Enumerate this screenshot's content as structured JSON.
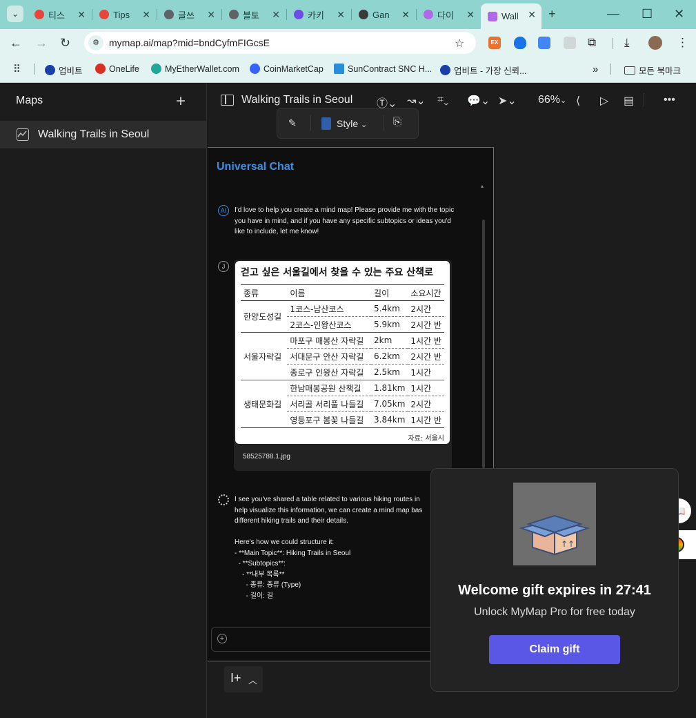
{
  "browser": {
    "tabs": [
      {
        "label": "티스",
        "color": "#e8453c"
      },
      {
        "label": "Tips",
        "color": "#e8453c"
      },
      {
        "label": "글쓰",
        "color": "#5f6368"
      },
      {
        "label": "블토",
        "color": "#5f6368"
      },
      {
        "label": "카키",
        "color": "#6c4de6"
      },
      {
        "label": "Gan",
        "color": "#3a3a3a"
      },
      {
        "label": "다이",
        "color": "#b06ae6"
      },
      {
        "label": "Wall",
        "color": "#b06ae6"
      }
    ],
    "new_tab": "+",
    "address": "mymap.ai/map?mid=bndCyfmFIGcsE",
    "bookmarks": [
      {
        "label": "업비트",
        "color": "#1b3fa8"
      },
      {
        "label": "OneLife",
        "color": "#d93025"
      },
      {
        "label": "MyEtherWallet.com",
        "color": "#21a69a"
      },
      {
        "label": "CoinMarketCap",
        "color": "#3861fb"
      },
      {
        "label": "SunContract SNC H...",
        "color": "#2b8dd6"
      },
      {
        "label": "업비트 - 가장 신뢰...",
        "color": "#1b3fa8"
      }
    ],
    "bookmarks_overflow": "»",
    "all_bookmarks": "모든 북마크",
    "ext_badge": "EX"
  },
  "sidebar": {
    "title": "Maps",
    "add": "+",
    "items": [
      {
        "label": "Walking Trails in Seoul"
      }
    ]
  },
  "toolbar": {
    "map_title": "Walking Trails in Seoul",
    "zoom": "66%",
    "style_label": "Style"
  },
  "chat": {
    "title": "Universal Chat",
    "ai_avatar": "AI",
    "user_avatar": "J",
    "ai_message": "I'd love to help you create a mind map! Please provide me with the topic\nyou have in mind, and if you have any specific subtopics or ideas you'd\nlike to include, let me know!",
    "image_caption": "58525788.1.jpg",
    "ai_reply": "I see you've shared a table related to various hiking routes in\nhelp visualize this information, we can create a mind map bas\ndifferent hiking trails and their details.\n\nHere's how we could structure it:\n- **Main Topic**: Hiking Trails in Seoul\n  - **Subtopics**:\n    - **내부 목록**\n      - 종류: 종류 (Type)\n      - 길이: 길",
    "input_placeholder": ""
  },
  "trail_image": {
    "heading": "걷고 싶은 서울길에서 찾을 수 있는 주요 산책로",
    "columns": [
      "종류",
      "이름",
      "길이",
      "소요시간"
    ],
    "groups": [
      {
        "type": "한양도성길",
        "rows": [
          {
            "name": "1코스-남산코스",
            "length": "5.4km",
            "time": "2시간"
          },
          {
            "name": "2코스-인왕산코스",
            "length": "5.9km",
            "time": "2시간 반"
          }
        ]
      },
      {
        "type": "서울자락길",
        "rows": [
          {
            "name": "마포구 매봉산 자락길",
            "length": "2km",
            "time": "1시간 반"
          },
          {
            "name": "서대문구 안산 자락길",
            "length": "6.2km",
            "time": "2시간 반"
          },
          {
            "name": "종로구 인왕산 자락길",
            "length": "2.5km",
            "time": "1시간"
          }
        ]
      },
      {
        "type": "생태문화길",
        "rows": [
          {
            "name": "한남매봉공원 산책길",
            "length": "1.81km",
            "time": "1시간"
          },
          {
            "name": "서리골 서리풀 나들길",
            "length": "7.05km",
            "time": "2시간"
          },
          {
            "name": "영등포구 봄꽃 나들길",
            "length": "3.84km",
            "time": "1시간 반"
          }
        ]
      }
    ],
    "source": "자료: 서울시"
  },
  "popup": {
    "title": "Welcome gift expires in 27:41",
    "subtitle": "Unlock MyMap Pro for free today",
    "button": "Claim gift"
  },
  "colors": {
    "accent": "#3b8fe8",
    "claim": "#5b57e6",
    "tabbar": "#8fd4cf"
  }
}
